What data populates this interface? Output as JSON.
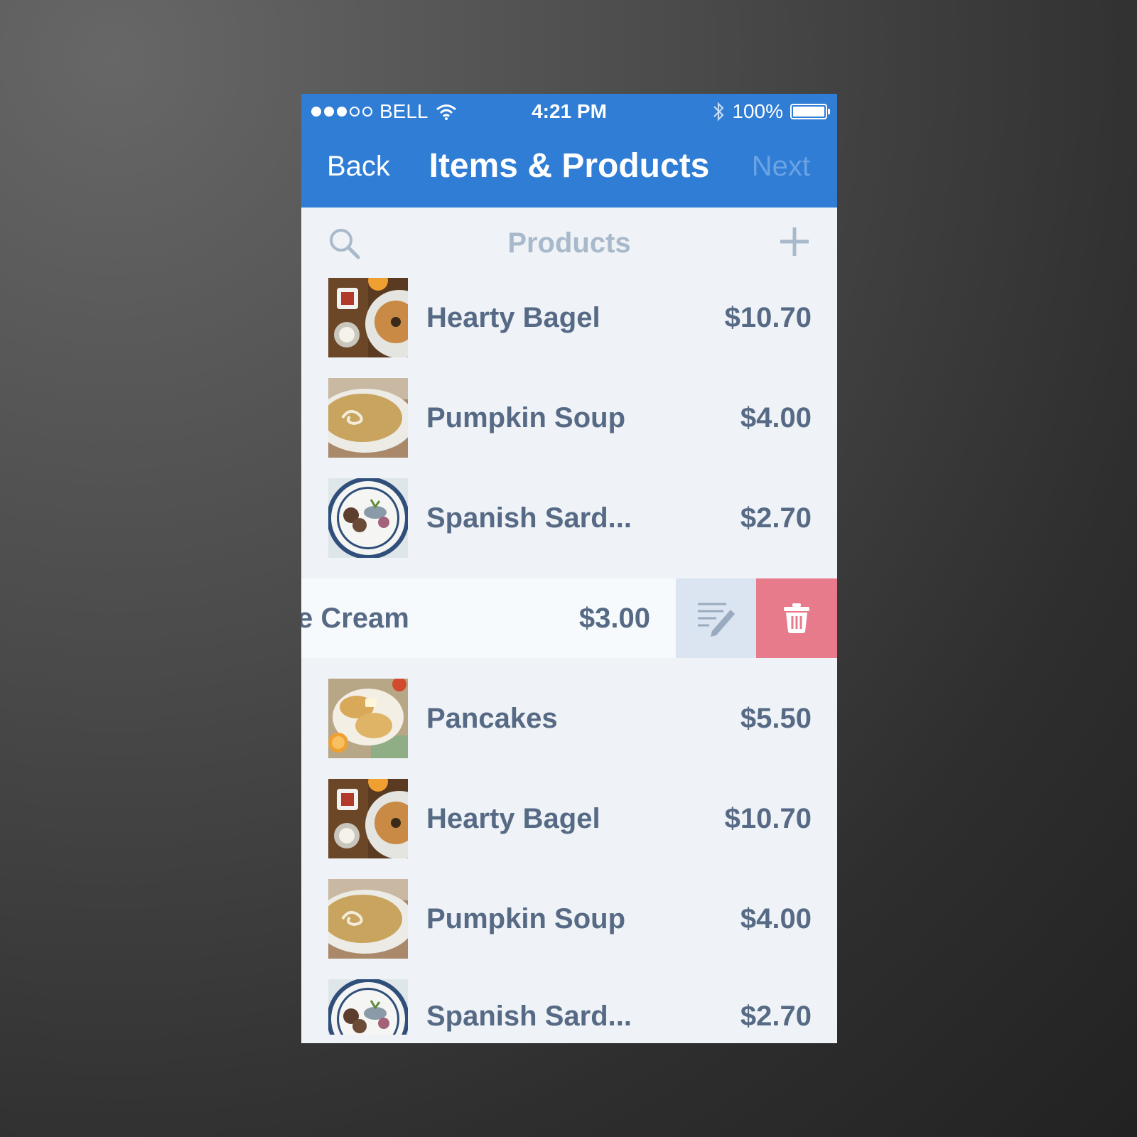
{
  "status_bar": {
    "carrier": "BELL",
    "time": "4:21 PM",
    "battery": "100%",
    "icons": [
      "signal-dots-icon",
      "wifi-icon",
      "bluetooth-icon",
      "battery-icon"
    ]
  },
  "nav": {
    "back": "Back",
    "title": "Items & Products",
    "next": "Next"
  },
  "search": {
    "title": "Products"
  },
  "rows": [
    {
      "name": "Hearty Bagel",
      "price": "$10.70",
      "image": "bagel"
    },
    {
      "name": "Pumpkin Soup",
      "price": "$4.00",
      "image": "soup"
    },
    {
      "name": "Spanish Sard...",
      "price": "$2.70",
      "image": "sardine"
    },
    {
      "name": "Pancakes",
      "price": "$5.50",
      "image": "pancake"
    },
    {
      "name": "Hearty Bagel",
      "price": "$10.70",
      "image": "bagel"
    },
    {
      "name": "Pumpkin Soup",
      "price": "$4.00",
      "image": "soup"
    },
    {
      "name": "Spanish Sard...",
      "price": "$2.70",
      "image": "sardine"
    }
  ],
  "swiped_row": {
    "name_partial": "e Cream",
    "price": "$3.00",
    "actions": [
      "edit-icon",
      "trash-icon"
    ]
  },
  "colors": {
    "accent": "#2f7dd4",
    "background": "#eff2f6",
    "text": "#566a85",
    "delete": "#e77a8b",
    "edit": "#dbe4f1"
  }
}
